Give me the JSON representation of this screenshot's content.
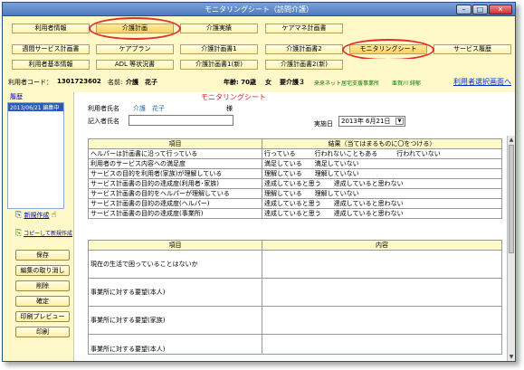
{
  "window": {
    "title": "モニタリングシート（訪問介護）"
  },
  "tabs_row1": [
    "利用者情報",
    "介護計画",
    "介護実績",
    "ケアマネ計画書"
  ],
  "tabs_row2": [
    "週間サービス計画書",
    "ケアプラン",
    "介護計画書1",
    "介護計画書2",
    "モニタリングシート",
    "サービス履歴"
  ],
  "tabs_row3": [
    "利用者基本情報",
    "ADL 等状況書",
    "介護計画書1(新)",
    "介護計画書2(新)"
  ],
  "info": {
    "code_label": "利用者コード：",
    "code": "1301723602",
    "name_label": "名前:",
    "name": "介護　花子",
    "age": "年齢: 70歳",
    "gender": "女",
    "care_level": "要介護３",
    "office": "来来ネット居宅支援事業所",
    "staff": "亜賀川 緋郁",
    "return_link": "利用者選択画面へ"
  },
  "left": {
    "history_label": "履歴",
    "history_item": "2013/06/21 編集中",
    "new_link": "新規作成",
    "copy_link": "コピーして新規作成",
    "buttons": [
      "保存",
      "編集の取り消し",
      "削除",
      "確定",
      "印刷プレビュー",
      "印刷"
    ]
  },
  "sheet": {
    "title": "モニタリングシート",
    "client_label": "利用者氏名",
    "client_name": "介護　花子",
    "honorific": "様",
    "writer_label": "記入者氏名",
    "date_label": "実施日",
    "date_value": "2013年 6月21日",
    "table1_headers": [
      "項目",
      "結果（当てはまるものに〇をつける）"
    ],
    "table1_rows": [
      {
        "item": "ヘルパーは計画書に沿って行っている",
        "result": "行っている　　　行われないこともある　　　行われていない"
      },
      {
        "item": "利用者のサービス内容への満足度",
        "result": "満足している　　満足していない"
      },
      {
        "item": "サービスの目的を利用者(家族)が理解している",
        "result": "理解している　　理解していない"
      },
      {
        "item": "サービス計画書の目的の達成度(利用者･家族)",
        "result": "達成していると思う　　達成していると思わない"
      },
      {
        "item": "サービス計画書の目的をヘルパーが理解している",
        "result": "理解している　　理解していない"
      },
      {
        "item": "サービス計画書の目的の達成度(ヘルパー)",
        "result": "達成していると思う　　達成していると思わない"
      },
      {
        "item": "サービス計画書の目的の達成度(事業所)",
        "result": "達成していると思う　　達成していると思わない"
      }
    ],
    "table2_headers": [
      "項目",
      "内容"
    ],
    "table2_rows": [
      "現在の生活で困っていることはないか",
      "事業所に対する要望(本人)",
      "事業所に対する要望(家族)",
      "事業所に対する要望(本人)"
    ]
  }
}
